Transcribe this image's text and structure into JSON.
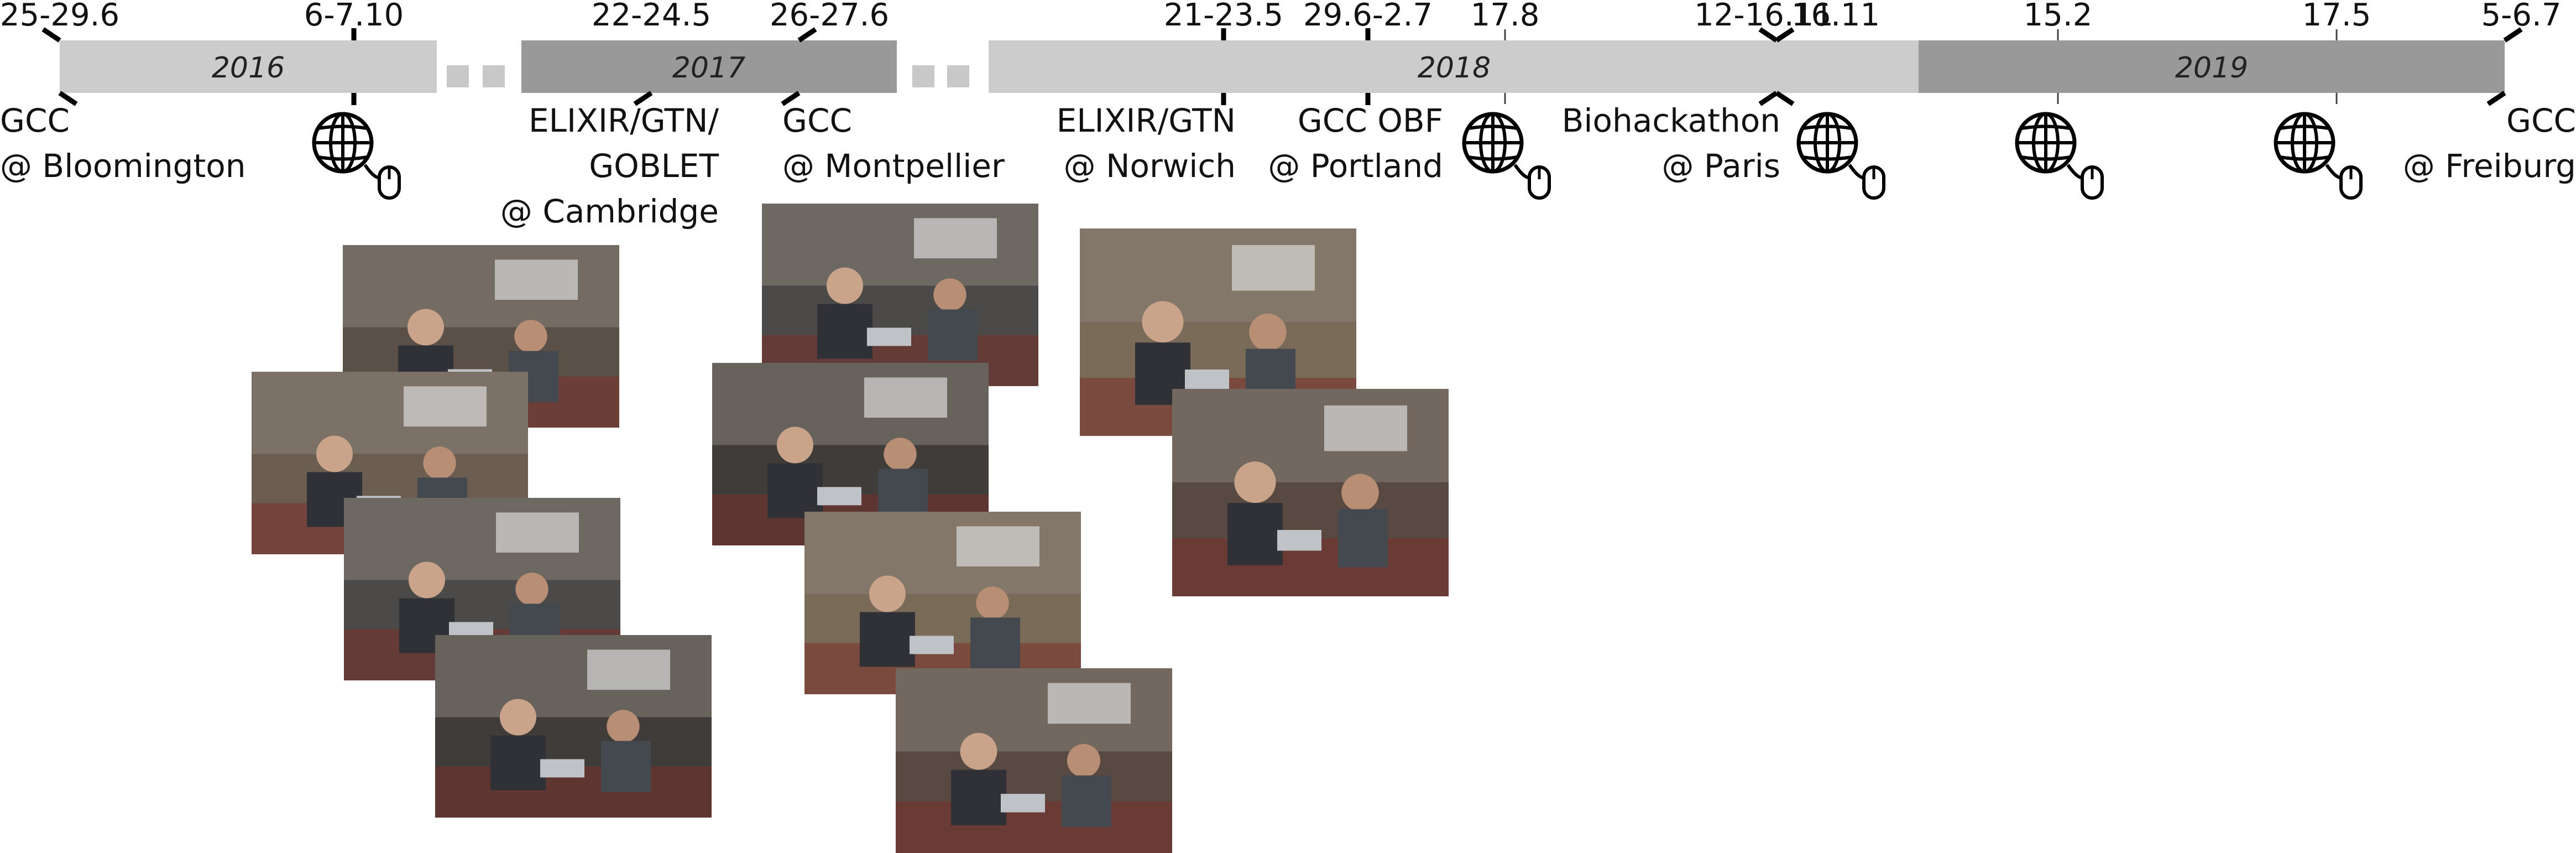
{
  "colors": {
    "band_light": "#cccccc",
    "band_dark": "#999999",
    "tick": "#000000",
    "text": "#111111"
  },
  "years": [
    {
      "label": "2016",
      "shade": "light"
    },
    {
      "label": "2017",
      "shade": "dark"
    },
    {
      "label": "2018",
      "shade": "light"
    },
    {
      "label": "2019",
      "shade": "dark"
    }
  ],
  "date_ticks": [
    "25-29.6",
    "6-7.10",
    "22-24.5",
    "26-27.6",
    "21-23.5",
    "29.6-2.7",
    "17.8",
    "12-16.11",
    "16.11",
    "15.2",
    "17.5",
    "5-6.7"
  ],
  "events": [
    {
      "lines": [
        "GCC",
        "@ Bloomington"
      ],
      "kind": "in-person"
    },
    {
      "lines": [],
      "kind": "online",
      "icon": "globe-mouse-icon"
    },
    {
      "lines": [
        "ELIXIR/GTN/",
        "GOBLET",
        "@ Cambridge"
      ],
      "kind": "in-person"
    },
    {
      "lines": [
        "GCC",
        "@ Montpellier"
      ],
      "kind": "in-person"
    },
    {
      "lines": [
        "ELIXIR/GTN",
        "@ Norwich"
      ],
      "kind": "in-person"
    },
    {
      "lines": [
        "GCC OBF",
        "@ Portland"
      ],
      "kind": "in-person"
    },
    {
      "lines": [],
      "kind": "online",
      "icon": "globe-mouse-icon"
    },
    {
      "lines": [
        "Biohackathon",
        "@ Paris"
      ],
      "kind": "in-person"
    },
    {
      "lines": [],
      "kind": "online",
      "icon": "globe-mouse-icon"
    },
    {
      "lines": [],
      "kind": "online",
      "icon": "globe-mouse-icon"
    },
    {
      "lines": [],
      "kind": "online",
      "icon": "globe-mouse-icon"
    },
    {
      "lines": [
        "GCC",
        "@ Freiburg"
      ],
      "kind": "in-person"
    }
  ],
  "photo_groups": [
    {
      "event": "GCC @ Bloomington",
      "count": 4
    },
    {
      "event": "GCC @ Montpellier",
      "count": 4
    },
    {
      "event": "ELIXIR/GTN @ Norwich",
      "count": 2
    }
  ]
}
